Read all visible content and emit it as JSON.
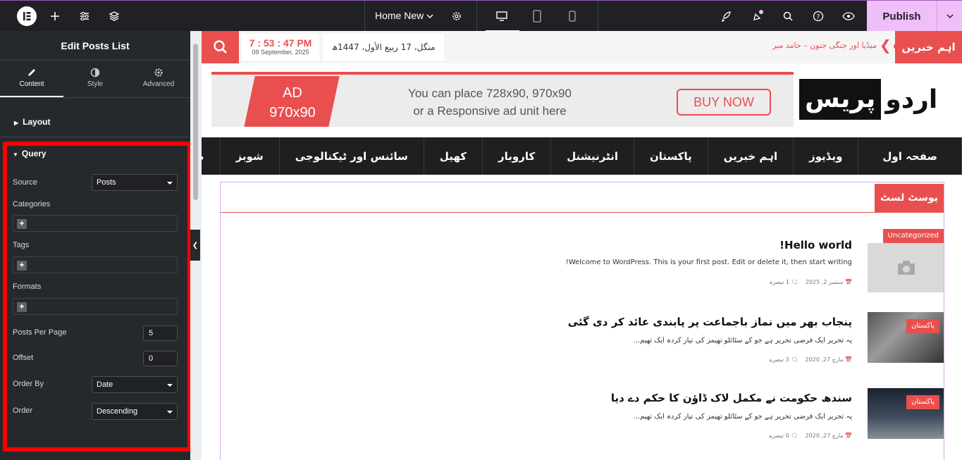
{
  "topbar": {
    "page_title": "Home New",
    "publish_label": "Publish"
  },
  "panel": {
    "title": "Edit Posts List",
    "tabs": [
      {
        "label": "Content"
      },
      {
        "label": "Style"
      },
      {
        "label": "Advanced"
      }
    ],
    "layout_label": "Layout",
    "query_label": "Query",
    "source_label": "Source",
    "source_value": "Posts",
    "categories_label": "Categories",
    "tags_label": "Tags",
    "formats_label": "Formats",
    "posts_per_page_label": "Posts Per Page",
    "posts_per_page_value": "5",
    "offset_label": "Offset",
    "offset_value": "0",
    "order_by_label": "Order By",
    "order_by_value": "Date",
    "order_label": "Order",
    "order_value": "Descending"
  },
  "site": {
    "time": "7 : 53 : 47 PM",
    "date_en": "09 September, 2025",
    "date_ur": "منگل، 17 ربیع الأول، 1447ھ",
    "ticker_label": "اہم خبریں",
    "ticker_text": "میڈیا اور جنگی جنون – حامد میر",
    "ad": {
      "badge_line1": "AD",
      "badge_line2": "970x90",
      "text_line1": "You can place 728x90, 970x90",
      "text_line2": "or a Responsive ad unit here",
      "button": "BUY NOW"
    },
    "brand_a": "اردو",
    "brand_b": "پریس",
    "nav": [
      "صفحہ اول",
      "ویڈیوز",
      "اہم خبریں",
      "پاکستان",
      "انٹرنیشنل",
      "کاروبار",
      "کھیل",
      "سائنس اور ٹیکنالوجی",
      "شوبز",
      "صحت"
    ],
    "widget_title": "پوسٹ لسٹ",
    "posts": [
      {
        "category": "Uncategorized",
        "title": "Hello world!",
        "excerpt": "Welcome to WordPress. This is your first post. Edit or delete it, then start writing!",
        "date": "ستمبر 2, 2025",
        "comments": "1 تبصرہ"
      },
      {
        "category": "پاکستان",
        "title": "پنجاب بھر میں نماز باجماعت پر پابندی عائد کر دی گئی",
        "excerpt": "یہ تحریر ایک فرضی تحریر ہے جو کے سٹائلو تھیمز کی تیار کردہ ایک تھیم...",
        "date": "مارچ 27, 2020",
        "comments": "3 تبصرے"
      },
      {
        "category": "پاکستان",
        "title": "سندھ حکومت نے مکمل لاک ڈاؤن کا حکم دے دیا",
        "excerpt": "یہ تحریر ایک فرضی تحریر ہے جو کے سٹائلو تھیمز کی تیار کردہ ایک تھیم...",
        "date": "مارچ 27, 2020",
        "comments": "0 تبصرے"
      }
    ]
  },
  "colors": {
    "accent": "#e94f4f",
    "editor_dark": "#26292c",
    "publish": "#f0bffa"
  }
}
